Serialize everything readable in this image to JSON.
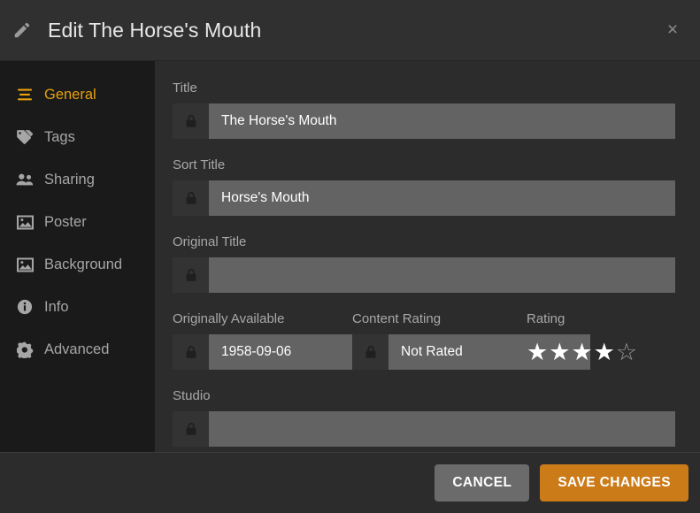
{
  "header": {
    "title": "Edit The Horse's Mouth",
    "edit_icon": "pencil-icon",
    "close_label": "×"
  },
  "sidebar": {
    "items": [
      {
        "label": "General",
        "icon": "list-icon",
        "active": true
      },
      {
        "label": "Tags",
        "icon": "tag-icon",
        "active": false
      },
      {
        "label": "Sharing",
        "icon": "people-icon",
        "active": false
      },
      {
        "label": "Poster",
        "icon": "image-icon",
        "active": false
      },
      {
        "label": "Background",
        "icon": "image-icon",
        "active": false
      },
      {
        "label": "Info",
        "icon": "info-icon",
        "active": false
      },
      {
        "label": "Advanced",
        "icon": "gear-icon",
        "active": false
      }
    ]
  },
  "form": {
    "title": {
      "label": "Title",
      "value": "The Horse's Mouth",
      "placeholder": "",
      "lock_icon": "lock-icon"
    },
    "sort_title": {
      "label": "Sort Title",
      "value": "Horse's Mouth",
      "placeholder": "",
      "lock_icon": "lock-icon"
    },
    "original_title": {
      "label": "Original Title",
      "value": "",
      "placeholder": "",
      "lock_icon": "lock-icon"
    },
    "originally_available": {
      "label": "Originally Available",
      "value": "1958-09-06",
      "placeholder": "",
      "lock_icon": "lock-icon"
    },
    "content_rating": {
      "label": "Content Rating",
      "value": "Not Rated",
      "placeholder": "",
      "lock_icon": "lock-icon"
    },
    "rating": {
      "label": "Rating",
      "value": 4,
      "max": 5,
      "filled_star": "★",
      "empty_star": "☆"
    },
    "studio": {
      "label": "Studio",
      "value": "",
      "placeholder": "",
      "lock_icon": "lock-icon"
    }
  },
  "footer": {
    "cancel_label": "CANCEL",
    "save_label": "SAVE CHANGES"
  },
  "colors": {
    "accent": "#e5a00d",
    "save_button": "#cc7b19",
    "sidebar_bg": "#1a1a1a",
    "panel_bg": "#2c2c2c",
    "input_bg": "#636363"
  }
}
